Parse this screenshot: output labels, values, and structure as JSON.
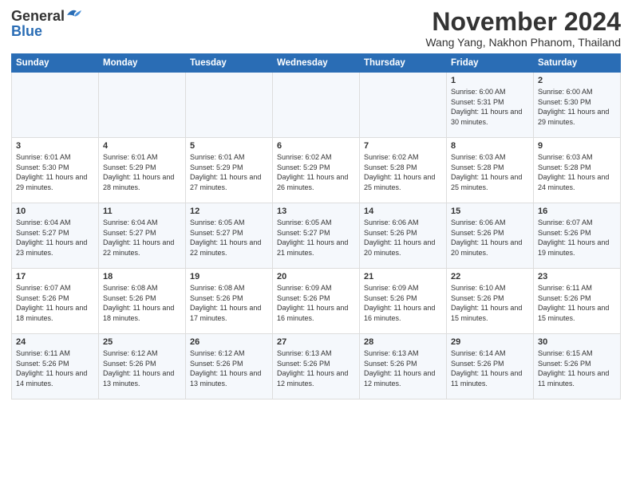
{
  "header": {
    "logo_general": "General",
    "logo_blue": "Blue",
    "month_title": "November 2024",
    "location": "Wang Yang, Nakhon Phanom, Thailand"
  },
  "calendar": {
    "days_of_week": [
      "Sunday",
      "Monday",
      "Tuesday",
      "Wednesday",
      "Thursday",
      "Friday",
      "Saturday"
    ],
    "weeks": [
      [
        {
          "day": "",
          "info": ""
        },
        {
          "day": "",
          "info": ""
        },
        {
          "day": "",
          "info": ""
        },
        {
          "day": "",
          "info": ""
        },
        {
          "day": "",
          "info": ""
        },
        {
          "day": "1",
          "info": "Sunrise: 6:00 AM\nSunset: 5:31 PM\nDaylight: 11 hours and 30 minutes."
        },
        {
          "day": "2",
          "info": "Sunrise: 6:00 AM\nSunset: 5:30 PM\nDaylight: 11 hours and 29 minutes."
        }
      ],
      [
        {
          "day": "3",
          "info": "Sunrise: 6:01 AM\nSunset: 5:30 PM\nDaylight: 11 hours and 29 minutes."
        },
        {
          "day": "4",
          "info": "Sunrise: 6:01 AM\nSunset: 5:29 PM\nDaylight: 11 hours and 28 minutes."
        },
        {
          "day": "5",
          "info": "Sunrise: 6:01 AM\nSunset: 5:29 PM\nDaylight: 11 hours and 27 minutes."
        },
        {
          "day": "6",
          "info": "Sunrise: 6:02 AM\nSunset: 5:29 PM\nDaylight: 11 hours and 26 minutes."
        },
        {
          "day": "7",
          "info": "Sunrise: 6:02 AM\nSunset: 5:28 PM\nDaylight: 11 hours and 25 minutes."
        },
        {
          "day": "8",
          "info": "Sunrise: 6:03 AM\nSunset: 5:28 PM\nDaylight: 11 hours and 25 minutes."
        },
        {
          "day": "9",
          "info": "Sunrise: 6:03 AM\nSunset: 5:28 PM\nDaylight: 11 hours and 24 minutes."
        }
      ],
      [
        {
          "day": "10",
          "info": "Sunrise: 6:04 AM\nSunset: 5:27 PM\nDaylight: 11 hours and 23 minutes."
        },
        {
          "day": "11",
          "info": "Sunrise: 6:04 AM\nSunset: 5:27 PM\nDaylight: 11 hours and 22 minutes."
        },
        {
          "day": "12",
          "info": "Sunrise: 6:05 AM\nSunset: 5:27 PM\nDaylight: 11 hours and 22 minutes."
        },
        {
          "day": "13",
          "info": "Sunrise: 6:05 AM\nSunset: 5:27 PM\nDaylight: 11 hours and 21 minutes."
        },
        {
          "day": "14",
          "info": "Sunrise: 6:06 AM\nSunset: 5:26 PM\nDaylight: 11 hours and 20 minutes."
        },
        {
          "day": "15",
          "info": "Sunrise: 6:06 AM\nSunset: 5:26 PM\nDaylight: 11 hours and 20 minutes."
        },
        {
          "day": "16",
          "info": "Sunrise: 6:07 AM\nSunset: 5:26 PM\nDaylight: 11 hours and 19 minutes."
        }
      ],
      [
        {
          "day": "17",
          "info": "Sunrise: 6:07 AM\nSunset: 5:26 PM\nDaylight: 11 hours and 18 minutes."
        },
        {
          "day": "18",
          "info": "Sunrise: 6:08 AM\nSunset: 5:26 PM\nDaylight: 11 hours and 18 minutes."
        },
        {
          "day": "19",
          "info": "Sunrise: 6:08 AM\nSunset: 5:26 PM\nDaylight: 11 hours and 17 minutes."
        },
        {
          "day": "20",
          "info": "Sunrise: 6:09 AM\nSunset: 5:26 PM\nDaylight: 11 hours and 16 minutes."
        },
        {
          "day": "21",
          "info": "Sunrise: 6:09 AM\nSunset: 5:26 PM\nDaylight: 11 hours and 16 minutes."
        },
        {
          "day": "22",
          "info": "Sunrise: 6:10 AM\nSunset: 5:26 PM\nDaylight: 11 hours and 15 minutes."
        },
        {
          "day": "23",
          "info": "Sunrise: 6:11 AM\nSunset: 5:26 PM\nDaylight: 11 hours and 15 minutes."
        }
      ],
      [
        {
          "day": "24",
          "info": "Sunrise: 6:11 AM\nSunset: 5:26 PM\nDaylight: 11 hours and 14 minutes."
        },
        {
          "day": "25",
          "info": "Sunrise: 6:12 AM\nSunset: 5:26 PM\nDaylight: 11 hours and 13 minutes."
        },
        {
          "day": "26",
          "info": "Sunrise: 6:12 AM\nSunset: 5:26 PM\nDaylight: 11 hours and 13 minutes."
        },
        {
          "day": "27",
          "info": "Sunrise: 6:13 AM\nSunset: 5:26 PM\nDaylight: 11 hours and 12 minutes."
        },
        {
          "day": "28",
          "info": "Sunrise: 6:13 AM\nSunset: 5:26 PM\nDaylight: 11 hours and 12 minutes."
        },
        {
          "day": "29",
          "info": "Sunrise: 6:14 AM\nSunset: 5:26 PM\nDaylight: 11 hours and 11 minutes."
        },
        {
          "day": "30",
          "info": "Sunrise: 6:15 AM\nSunset: 5:26 PM\nDaylight: 11 hours and 11 minutes."
        }
      ]
    ]
  }
}
